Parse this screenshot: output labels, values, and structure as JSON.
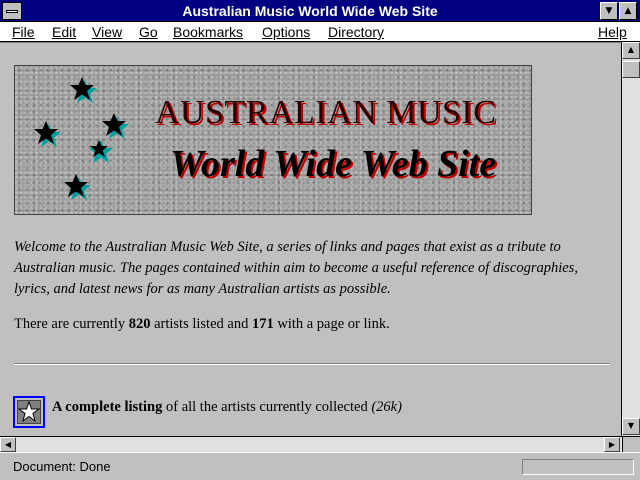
{
  "window": {
    "title": "Australian Music World Wide Web Site"
  },
  "menu": {
    "file": "File",
    "edit": "Edit",
    "view": "View",
    "go": "Go",
    "bookmarks": "Bookmarks",
    "options": "Options",
    "directory": "Directory",
    "help": "Help"
  },
  "banner": {
    "line1": "AUSTRALIAN MUSIC",
    "line2": "World Wide Web Site"
  },
  "welcome": "Welcome to the Australian Music Web Site, a series of links and pages that exist as a tribute to Australian music. The pages contained within aim to become a useful reference of discographies, lyrics, and latest news for as many Australian artists as possible.",
  "count": {
    "prefix": "There are currently ",
    "artists": "820",
    "middle": " artists listed and ",
    "pages": "171",
    "suffix": " with a page or link."
  },
  "listing": {
    "bold": "A complete listing",
    "text": " of all the artists currently collected ",
    "size": "(26k)"
  },
  "status": {
    "text": "Document: Done"
  },
  "colors": {
    "titlebar": "#000080",
    "accent_red": "#c00000",
    "star_cyan": "#00a0a0"
  }
}
